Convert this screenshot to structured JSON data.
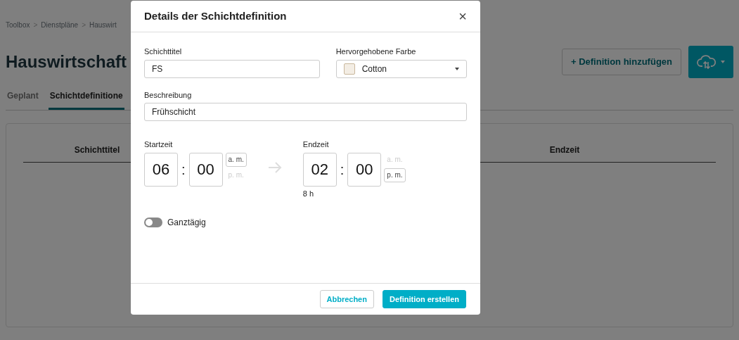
{
  "breadcrumb": {
    "items": [
      "Toolbox",
      "Dienstpläne",
      "Hauswirt"
    ],
    "separators": [
      ">",
      ">"
    ]
  },
  "page_title": "Hauswirtschaft",
  "tabs": [
    {
      "label": "Geplant",
      "selected": false
    },
    {
      "label": "Schichtdefinitione",
      "selected": true
    }
  ],
  "add_button": {
    "label": "+ Definition hinzufügen"
  },
  "table": {
    "columns": [
      "Schichttitel",
      "Endzeit"
    ]
  },
  "modal": {
    "title": "Details der Schichtdefinition",
    "close": "×",
    "title_field": {
      "label": "Schichttitel",
      "value": "FS"
    },
    "color_field": {
      "label": "Hervorgehobene Farbe",
      "value": "Cotton",
      "color": "#f3ede4"
    },
    "description_field": {
      "label": "Beschreibung",
      "value": "Frühschicht"
    },
    "start": {
      "label": "Startzeit",
      "hour": "06",
      "colon": ":",
      "minute": "00",
      "am": "a. m.",
      "pm": "p. m.",
      "am_selected": true
    },
    "end": {
      "label": "Endzeit",
      "hour": "02",
      "colon": ":",
      "minute": "00",
      "am": "a. m.",
      "pm": "p. m.",
      "am_selected": false,
      "duration": "8 h"
    },
    "all_day": {
      "label": "Ganztägig",
      "on": false
    },
    "buttons": [
      {
        "label": "Abbrechen",
        "kind": "secondary"
      },
      {
        "label": "Definition erstellen",
        "kind": "primary"
      }
    ]
  }
}
